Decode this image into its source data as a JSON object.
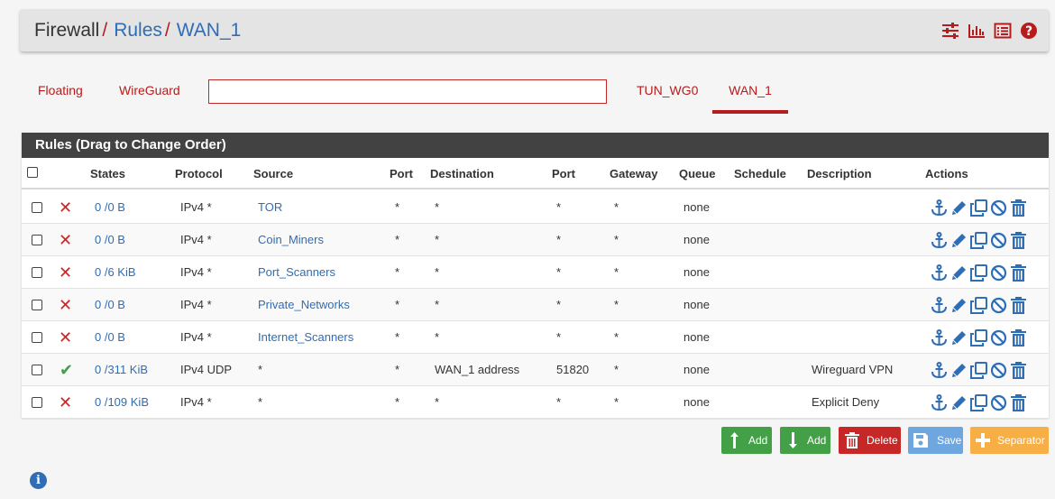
{
  "breadcrumb": {
    "base": "Firewall",
    "sep": "/",
    "rules": "Rules",
    "current": "WAN_1"
  },
  "header_icons": [
    "sliders-icon",
    "chart-icon",
    "list-icon",
    "help-icon"
  ],
  "tabs": [
    {
      "label": "Floating",
      "active": false
    },
    {
      "label": "WireGuard",
      "active": false
    },
    {
      "label": "",
      "active": false
    },
    {
      "label": "TUN_WG0",
      "active": false
    },
    {
      "label": "WAN_1",
      "active": true
    }
  ],
  "panel": {
    "title": "Rules (Drag to Change Order)"
  },
  "columns": [
    "States",
    "Protocol",
    "Source",
    "Port",
    "Destination",
    "Port",
    "Gateway",
    "Queue",
    "Schedule",
    "Description",
    "Actions"
  ],
  "rows": [
    {
      "status": "block",
      "status_glyph": "✕",
      "states": "0 /0 B",
      "protocol": "IPv4 *",
      "source": "TOR",
      "sport": "*",
      "dest": "*",
      "dport": "*",
      "gateway": "*",
      "queue": "none",
      "schedule": "",
      "description": ""
    },
    {
      "status": "block",
      "status_glyph": "✕",
      "states": "0 /0 B",
      "protocol": "IPv4 *",
      "source": "Coin_Miners",
      "sport": "*",
      "dest": "*",
      "dport": "*",
      "gateway": "*",
      "queue": "none",
      "schedule": "",
      "description": ""
    },
    {
      "status": "block",
      "status_glyph": "✕",
      "states": "0 /6 KiB",
      "protocol": "IPv4 *",
      "source": "Port_Scanners",
      "sport": "*",
      "dest": "*",
      "dport": "*",
      "gateway": "*",
      "queue": "none",
      "schedule": "",
      "description": ""
    },
    {
      "status": "block",
      "status_glyph": "✕",
      "states": "0 /0 B",
      "protocol": "IPv4 *",
      "source": "Private_Networks",
      "sport": "*",
      "dest": "*",
      "dport": "*",
      "gateway": "*",
      "queue": "none",
      "schedule": "",
      "description": ""
    },
    {
      "status": "block",
      "status_glyph": "✕",
      "states": "0 /0 B",
      "protocol": "IPv4 *",
      "source": "Internet_Scanners",
      "sport": "*",
      "dest": "*",
      "dport": "*",
      "gateway": "*",
      "queue": "none",
      "schedule": "",
      "description": ""
    },
    {
      "status": "pass",
      "status_glyph": "✔",
      "states": "0 /311 KiB",
      "protocol": "IPv4 UDP",
      "source": "*",
      "sport": "*",
      "dest": "WAN_1 address",
      "dport": "51820",
      "gateway": "*",
      "queue": "none",
      "schedule": "",
      "description": "Wireguard VPN"
    },
    {
      "status": "block",
      "status_glyph": "✕",
      "states": "0 /109 KiB",
      "protocol": "IPv4 *",
      "source": "*",
      "sport": "*",
      "dest": "*",
      "dport": "*",
      "gateway": "*",
      "queue": "none",
      "schedule": "",
      "description": "Explicit Deny"
    }
  ],
  "buttons": {
    "add_top": "Add",
    "add_bottom": "Add",
    "delete": "Delete",
    "save": "Save",
    "separator": "Separator"
  },
  "info_glyph": "i",
  "colors": {
    "accent": "#b71c1c",
    "link": "#2f6db5",
    "panel_head": "#424242",
    "pass": "#43a047",
    "block": "#c62828"
  }
}
